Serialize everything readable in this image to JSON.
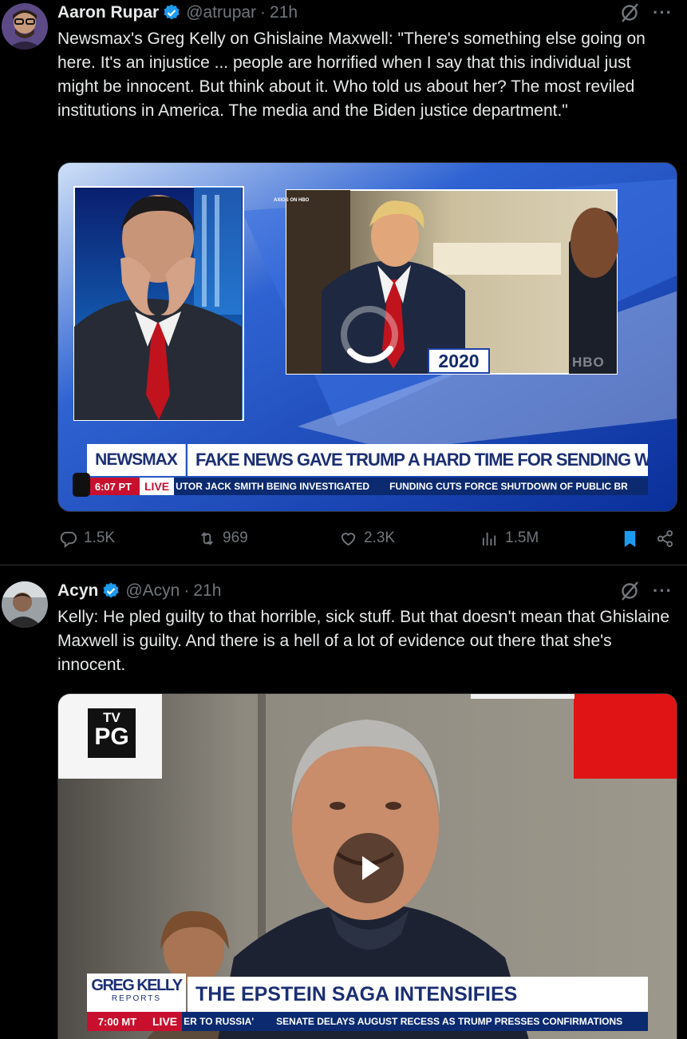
{
  "tweets": [
    {
      "author_name": "Aaron Rupar",
      "handle": "@atrupar",
      "separator": "·",
      "time": "21h",
      "more": "···",
      "text": "Newsmax's Greg Kelly on Ghislaine Maxwell: \"There's something else going on here. It's an injustice ... people are horrified when I say that this individual just might be innocent. But think about it. Who told us about her? The most reviled institutions in America. The media and the Biden justice department.\"",
      "media": {
        "tag_small": "AXIOS ON HBO",
        "year_badge": "2020",
        "network_watermark": "HBO",
        "network_logo": "NEWSMAX",
        "headline": "FAKE NEWS GAVE TRUMP A HARD TIME FOR SENDING WELL WISHES",
        "clock": "6:07 PT",
        "live": "LIVE",
        "ticker_1": "UTOR JACK SMITH BEING INVESTIGATED",
        "ticker_2": "FUNDING CUTS FORCE SHUTDOWN OF PUBLIC BR",
        "loading": 0.72
      },
      "stats": {
        "replies": "1.5K",
        "reposts": "969",
        "likes": "2.3K",
        "views": "1.5M"
      }
    },
    {
      "author_name": "Acyn",
      "handle": "@Acyn",
      "separator": "·",
      "time": "21h",
      "more": "···",
      "text": "Kelly: He pled guilty to that horrible, sick stuff. But that doesn't mean that Ghislaine Maxwell is guilty. And there is a hell of a lot of evidence out there that she's innocent.",
      "media": {
        "rating_top": "TV",
        "rating": "PG",
        "show_logo": "GREG KELLY",
        "show_logo_sub": "REPORTS",
        "headline": "THE EPSTEIN SAGA INTENSIFIES",
        "clock": "7:00 MT",
        "live": "LIVE",
        "ticker_1": "ER TO RUSSIA'",
        "ticker_2": "SENATE DELAYS AUGUST RECESS AS TRUMP PRESSES CONFIRMATIONS"
      }
    }
  ],
  "colors": {
    "accent": "#1d9bf0",
    "muted": "#71767b",
    "text": "#e7e9ea",
    "bg": "#000000",
    "divider": "#2f3336"
  },
  "icons": [
    "verified-badge-icon",
    "grok-icon",
    "more-icon",
    "reply-icon",
    "repost-icon",
    "like-icon",
    "views-icon",
    "bookmark-icon",
    "share-icon",
    "play-icon"
  ]
}
